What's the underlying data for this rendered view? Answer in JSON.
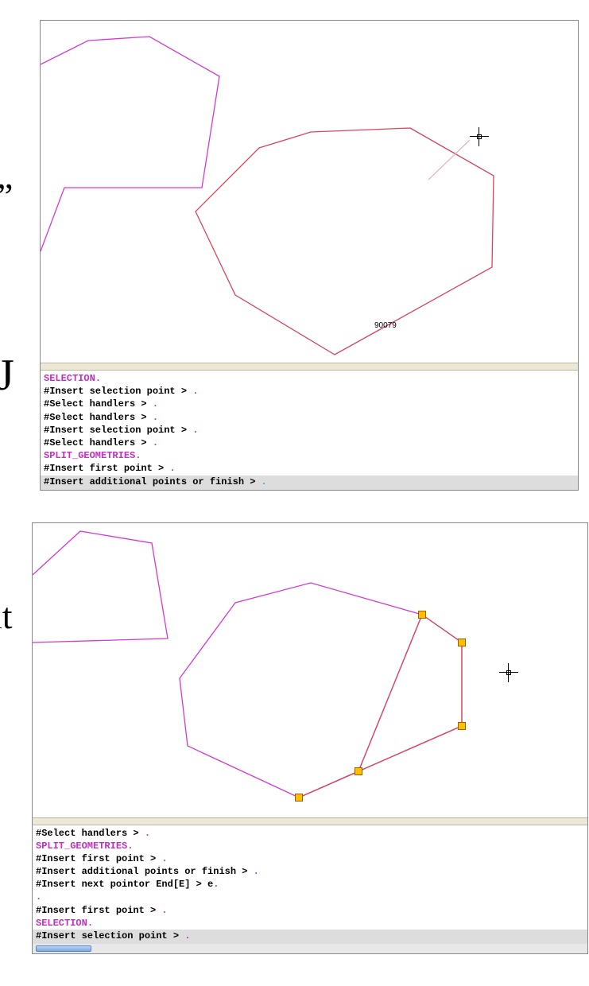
{
  "sidechars": {
    "a": "”",
    "b": "J",
    "c": "it"
  },
  "colors": {
    "polygon1": "#d33ad3",
    "polygon2": "#d94560",
    "splitline": "#e8a8c0",
    "handle": "#fdbf00"
  },
  "top": {
    "object_label": "90079",
    "log": [
      {
        "type": "cmd",
        "text": "SELECTION"
      },
      {
        "type": "line",
        "text": "#Insert selection point > "
      },
      {
        "type": "line",
        "text": "#Select handlers > "
      },
      {
        "type": "line",
        "text": "#Select handlers > "
      },
      {
        "type": "line",
        "text": "#Insert selection point > "
      },
      {
        "type": "line",
        "text": "#Select handlers > "
      },
      {
        "type": "cmd",
        "text": "SPLIT_GEOMETRIES"
      },
      {
        "type": "line",
        "text": "#Insert first point > "
      }
    ],
    "input": "#Insert additional points or finish > "
  },
  "bottom": {
    "log": [
      {
        "type": "line",
        "text": "#Select handlers > "
      },
      {
        "type": "cmd",
        "text": "SPLIT_GEOMETRIES"
      },
      {
        "type": "line",
        "text": "#Insert first point > "
      },
      {
        "type": "line",
        "text": "#Insert additional points or finish > "
      },
      {
        "type": "line",
        "text": "#Insert next pointor End[E] > e"
      },
      {
        "type": "blank",
        "text": ""
      },
      {
        "type": "line",
        "text": "#Insert first point > "
      },
      {
        "type": "cmd",
        "text": "SELECTION"
      }
    ],
    "input": "#Insert selection point > "
  }
}
